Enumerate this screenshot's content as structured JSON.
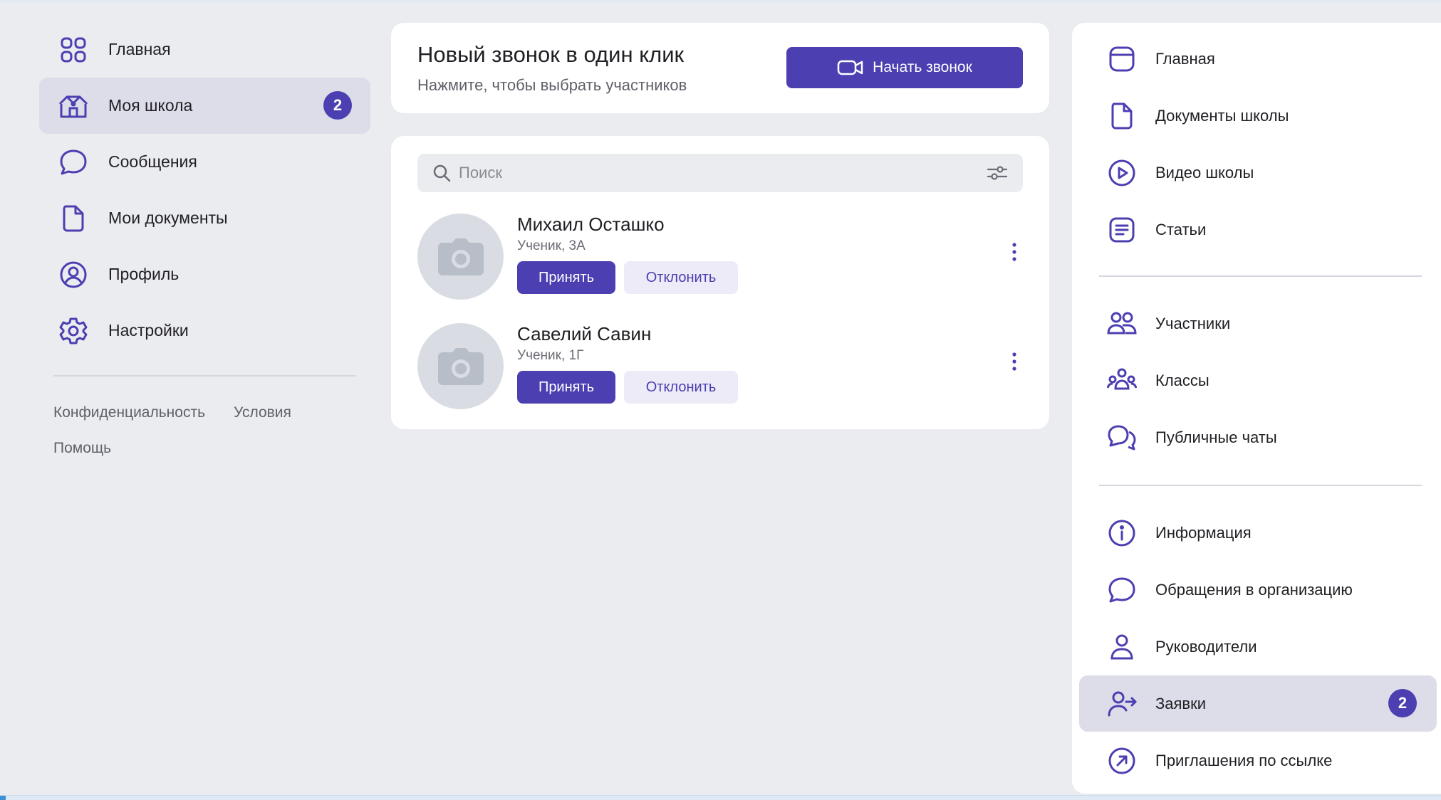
{
  "left_nav": {
    "items": [
      {
        "label": "Главная",
        "icon": "grid-icon"
      },
      {
        "label": "Моя школа",
        "icon": "school-icon",
        "badge": "2"
      },
      {
        "label": "Сообщения",
        "icon": "message-icon"
      },
      {
        "label": "Мои документы",
        "icon": "document-icon"
      },
      {
        "label": "Профиль",
        "icon": "profile-icon"
      },
      {
        "label": "Настройки",
        "icon": "gear-icon"
      }
    ],
    "footer": {
      "privacy": "Конфиденциальность",
      "terms": "Условия",
      "help": "Помощь"
    }
  },
  "call": {
    "title": "Новый звонок в один клик",
    "subtitle": "Нажмите, чтобы выбрать участников",
    "button": "Начать звонок"
  },
  "search": {
    "placeholder": "Поиск"
  },
  "requests": [
    {
      "name": "Михаил Осташко",
      "role": "Ученик, 3А",
      "accept": "Принять",
      "decline": "Отклонить"
    },
    {
      "name": "Савелий Савин",
      "role": "Ученик, 1Г",
      "accept": "Принять",
      "decline": "Отклонить"
    }
  ],
  "right_nav": {
    "group1": [
      {
        "label": "Главная",
        "icon": "home-icon"
      },
      {
        "label": "Документы школы",
        "icon": "document-icon"
      },
      {
        "label": "Видео школы",
        "icon": "play-icon"
      },
      {
        "label": "Статьи",
        "icon": "article-icon"
      }
    ],
    "group2": [
      {
        "label": "Участники",
        "icon": "users-icon"
      },
      {
        "label": "Классы",
        "icon": "group-icon"
      },
      {
        "label": "Публичные чаты",
        "icon": "chats-icon"
      }
    ],
    "group3": [
      {
        "label": "Информация",
        "icon": "info-icon"
      },
      {
        "label": "Обращения в организацию",
        "icon": "message-icon"
      },
      {
        "label": "Руководители",
        "icon": "user-icon"
      },
      {
        "label": "Заявки",
        "icon": "user-arrow-icon",
        "badge": "2"
      },
      {
        "label": "Приглашения по ссылке",
        "icon": "link-arrow-icon"
      }
    ]
  },
  "colors": {
    "accent": "#4b3fb1",
    "background": "#ebecf0",
    "active": "#dcdde8"
  }
}
